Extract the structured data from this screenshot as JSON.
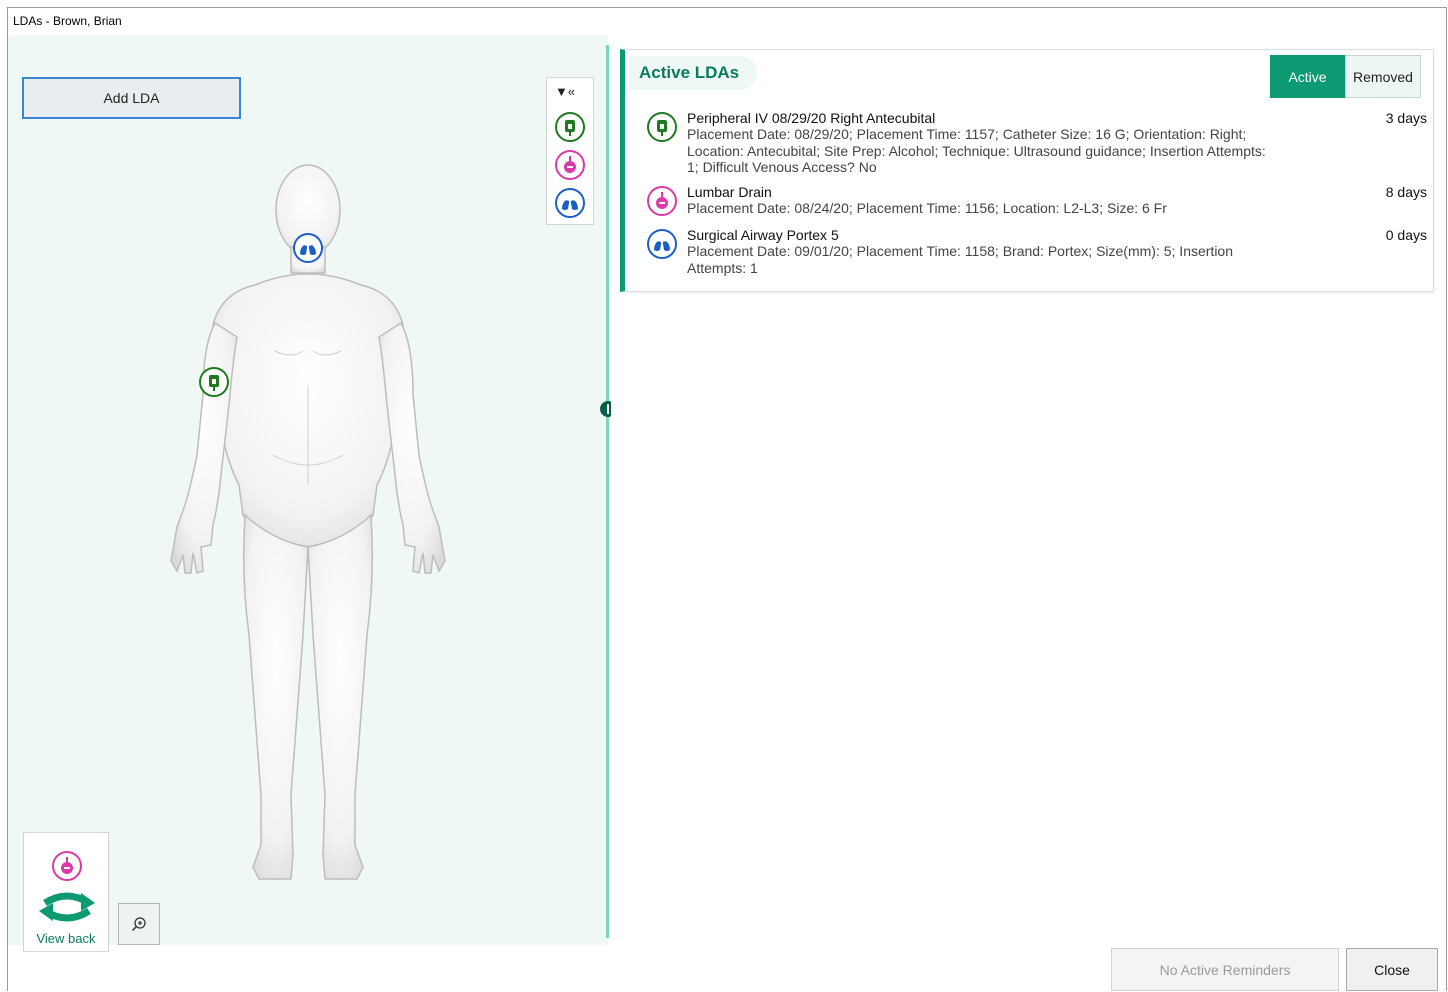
{
  "window": {
    "title": "LDAs - Brown, Brian"
  },
  "left": {
    "add_button": "Add LDA",
    "view_back_label": "View back"
  },
  "card": {
    "title": "Active LDAs",
    "toggle_active": "Active",
    "toggle_removed": "Removed",
    "items": [
      {
        "name": "Peripheral IV 08/29/20 Right Antecubital",
        "detail": "Placement Date: 08/29/20; Placement Time: 1157; Catheter Size: 16 G; Orientation: Right; Location: Antecubital; Site Prep: Alcohol; Technique: Ultrasound guidance; Insertion Attempts: 1; Difficult Venous Access? No",
        "days": "3 days",
        "icon": "iv-bag-icon",
        "color": "#1f7a1f"
      },
      {
        "name": "Lumbar Drain",
        "detail": "Placement Date: 08/24/20; Placement Time: 1156; Location: L2-L3; Size: 6 Fr",
        "days": "8 days",
        "icon": "drain-bulb-icon",
        "color": "#d93aa6"
      },
      {
        "name": "Surgical Airway Portex 5",
        "detail": "Placement Date: 09/01/20; Placement Time: 1158; Brand: Portex; Size(mm): 5; Insertion Attempts: 1",
        "days": "0 days",
        "icon": "lungs-icon",
        "color": "#1a5fc8"
      }
    ]
  },
  "footer": {
    "reminders_button": "No Active Reminders",
    "close_button": "Close"
  },
  "colors": {
    "accent": "#0b9a72",
    "iv": "#1f7a1f",
    "drain": "#d93aa6",
    "airway": "#1a5fc8"
  }
}
